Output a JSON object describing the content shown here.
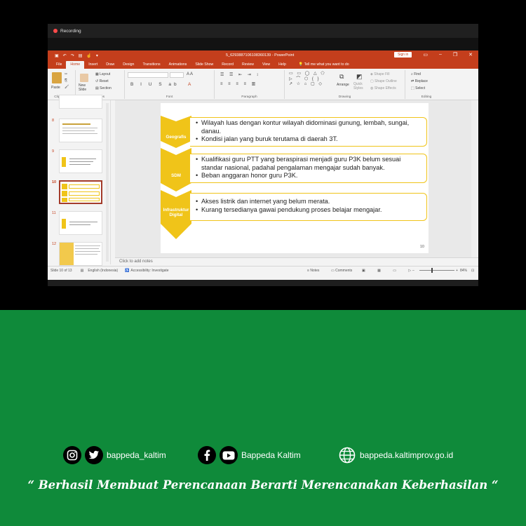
{
  "recording": {
    "label": "Recording"
  },
  "ppt": {
    "file_title": "5_6293887106108360139  -  PowerPoint",
    "signin": "Sign in",
    "tabs": [
      "File",
      "Home",
      "Insert",
      "Draw",
      "Design",
      "Transitions",
      "Animations",
      "Slide Show",
      "Record",
      "Review",
      "View",
      "Help"
    ],
    "active_tab": "Home",
    "tell_me": "Tell me what you want to do",
    "ribbon": {
      "clipboard": "Clipboard",
      "paste": "Paste",
      "new_slide": "New Slide",
      "layout": "Layout",
      "reset": "Reset",
      "section": "Section",
      "slides": "Slides",
      "font": "Font",
      "paragraph": "Paragraph",
      "drawing": "Drawing",
      "arrange": "Arrange",
      "quick_styles": "Quick Styles",
      "shape_fill": "Shape Fill",
      "shape_outline": "Shape Outline",
      "shape_effects": "Shape Effects",
      "find": "Find",
      "replace": "Replace",
      "select": "Select",
      "editing": "Editing"
    },
    "thumbnails": [
      {
        "num": "8"
      },
      {
        "num": "9"
      },
      {
        "num": "10"
      },
      {
        "num": "11"
      },
      {
        "num": "12"
      }
    ],
    "slide": {
      "sections": [
        {
          "label": "Geografis",
          "bullets": [
            "Wilayah luas dengan kontur wilayah didominasi gunung, lembah, sungai, danau.",
            "Kondisi jalan yang buruk terutama di daerah 3T."
          ]
        },
        {
          "label": "SDM",
          "bullets": [
            "Kualifikasi guru PTT yang beraspirasi menjadi guru P3K belum sesuai standar nasional, padahal pengalaman mengajar sudah banyak.",
            "Beban anggaran honor guru P3K."
          ]
        },
        {
          "label": "Infrastruktur Digital",
          "bullets": [
            "Akses listrik dan internet yang belum merata.",
            "Kurang tersedianya gawai pendukung proses belajar mengajar."
          ]
        }
      ],
      "page_number": "10"
    },
    "notes_placeholder": "Click to add notes",
    "status": {
      "slide": "Slide 10 of 13",
      "language": "English (Indonesia)",
      "accessibility": "Accessibility: Investigate",
      "notes": "Notes",
      "comments": "Comments",
      "zoom": "84%"
    }
  },
  "footer": {
    "instagram_twitter_handle": "bappeda_kaltim",
    "facebook_youtube_name": "Bappeda Kaltim",
    "website": "bappeda.kaltimprov.go.id",
    "quote": "“ Berhasil  Membuat Perencanaan Berarti Merencanakan Keberhasilan “"
  },
  "colors": {
    "ppt_accent": "#c43e1c",
    "chevron_yellow": "#f0c419",
    "green_band": "#0f8a3a"
  }
}
